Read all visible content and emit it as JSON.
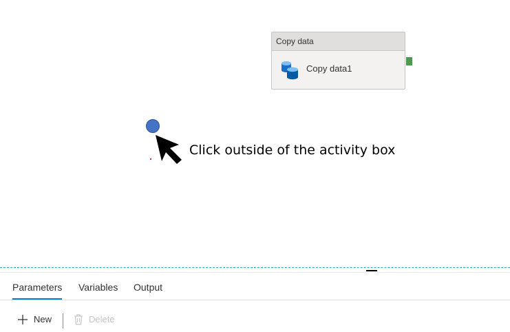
{
  "activity": {
    "type_label": "Copy data",
    "name": "Copy data1",
    "icon": "copy-data-icon"
  },
  "annotation": {
    "instruction": "Click outside of the activity box"
  },
  "tabs": [
    {
      "label": "Parameters",
      "active": true
    },
    {
      "label": "Variables",
      "active": false
    },
    {
      "label": "Output",
      "active": false
    }
  ],
  "toolbar": {
    "new_label": "New",
    "delete_label": "Delete"
  },
  "colors": {
    "accent": "#0078d4",
    "click_dot": "#4472c4",
    "output_port": "#4c9a4c",
    "splitter": "#2aa7b8"
  }
}
